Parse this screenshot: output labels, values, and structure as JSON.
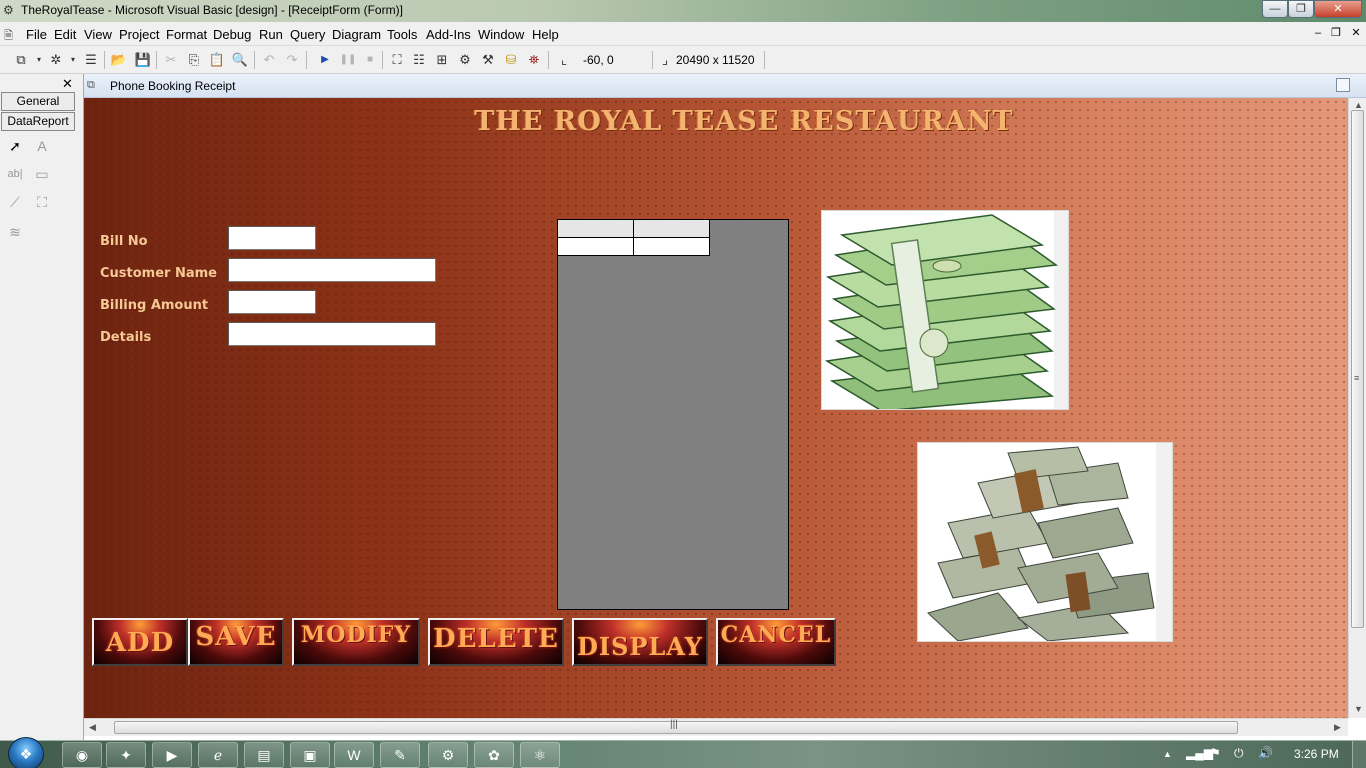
{
  "window": {
    "title": "TheRoyalTease - Microsoft Visual Basic [design] - [ReceiptForm (Form)]",
    "minimize_label": "—",
    "maximize_label": "❐",
    "close_label": "✕"
  },
  "menu": {
    "items": [
      "File",
      "Edit",
      "View",
      "Project",
      "Format",
      "Debug",
      "Run",
      "Query",
      "Diagram",
      "Tools",
      "Add-Ins",
      "Window",
      "Help"
    ]
  },
  "toolbar": {
    "position": "-60, 0",
    "size": "20490 x 11520"
  },
  "toolbox": {
    "close_label": "✕",
    "tabs": [
      "General",
      "DataReport"
    ]
  },
  "document": {
    "title": "Phone Booking Receipt"
  },
  "form": {
    "heading": "THE ROYAL TEASE RESTAURANT",
    "fields": [
      {
        "label": "Bill No",
        "value": ""
      },
      {
        "label": "Customer Name",
        "value": ""
      },
      {
        "label": "Billing Amount",
        "value": ""
      },
      {
        "label": "Details",
        "value": ""
      }
    ],
    "buttons": [
      "ADD",
      "SAVE",
      "MODIFY",
      "DELETE",
      "DISPLAY",
      "CANCEL"
    ]
  },
  "taskbar": {
    "time": "3:26 PM"
  },
  "colors": {
    "form_background": "#a8482e",
    "heading": "#f4b36e",
    "label": "#f6c894",
    "button_text": "#ffaa55"
  }
}
